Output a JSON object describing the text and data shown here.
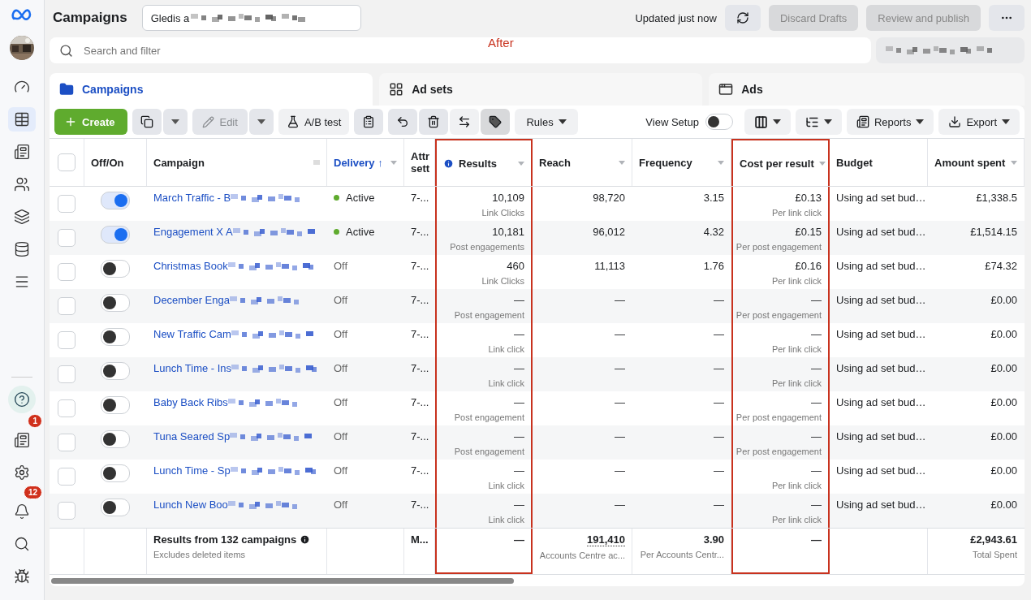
{
  "page_title": "Campaigns",
  "account": {
    "name": "Gledis a"
  },
  "updated": "Updated just now",
  "header_buttons": [
    {
      "label": "Discard Drafts",
      "disabled": true
    },
    {
      "label": "Review and publish",
      "disabled": true
    }
  ],
  "search": {
    "placeholder": "Search and filter"
  },
  "annotation": {
    "label": "After"
  },
  "sidebar": {
    "items": [
      {
        "kind": "gauge",
        "selected": false
      },
      {
        "kind": "table",
        "selected": true
      },
      {
        "kind": "pages",
        "selected": false
      },
      {
        "kind": "people",
        "selected": false
      },
      {
        "kind": "layers",
        "selected": false
      },
      {
        "kind": "stack",
        "selected": false
      },
      {
        "kind": "menu",
        "selected": false
      }
    ],
    "bottom": [
      {
        "kind": "help"
      },
      {
        "kind": "news",
        "badge": "1"
      },
      {
        "kind": "settings"
      },
      {
        "kind": "bell",
        "badge": "12"
      },
      {
        "kind": "search"
      },
      {
        "kind": "bug"
      }
    ]
  },
  "tabs": [
    {
      "kind": "campaigns",
      "label": "Campaigns",
      "selected": true
    },
    {
      "kind": "adsets",
      "label": "Ad sets",
      "selected": false
    },
    {
      "kind": "ads",
      "label": "Ads",
      "selected": false
    }
  ],
  "toolbar": {
    "create": "Create",
    "edit": {
      "label": "Edit",
      "disabled": true
    },
    "ab_test": "A/B test",
    "rules": "Rules",
    "view_setup": {
      "label": "View Setup",
      "on": false
    },
    "reports": "Reports",
    "export": "Export"
  },
  "table": {
    "columns": [
      {
        "kind": "check",
        "checked": false
      },
      {
        "kind": "text",
        "label": "Off/On"
      },
      {
        "kind": "handle",
        "label": "Campaign"
      },
      {
        "kind": "sort",
        "label": "Delivery",
        "sort_mark": "↑",
        "sorted": true
      },
      {
        "kind": "split",
        "label": "Attr",
        "label2": "sett"
      },
      {
        "kind": "info",
        "label": "Results",
        "highlighted": true
      },
      {
        "kind": "text",
        "label": "Reach",
        "highlighted": false
      },
      {
        "kind": "text",
        "label": "Frequency"
      },
      {
        "kind": "text",
        "label": "Cost per result",
        "highlighted": true
      },
      {
        "kind": "text",
        "label": "Budget"
      },
      {
        "kind": "text",
        "label": "Amount spent"
      }
    ],
    "rows": [
      {
        "checked": false,
        "on": true,
        "name": "March Traffic - B",
        "delivery": "Active",
        "active": true,
        "attribution": "7-...",
        "results": "10,109",
        "results_type": "Link Clicks",
        "reach": "98,720",
        "frequency": "3.15",
        "cost": "£0.13",
        "cost_type": "Per link click",
        "budget": "Using ad set bud…",
        "spent": "£1,338.5"
      },
      {
        "checked": false,
        "on": true,
        "name": "Engagement X A",
        "delivery": "Active",
        "active": true,
        "attribution": "7-...",
        "results": "10,181",
        "results_type": "Post engagements",
        "reach": "96,012",
        "frequency": "4.32",
        "cost": "£0.15",
        "cost_type": "Per post engagement",
        "budget": "Using ad set bud…",
        "spent": "£1,514.15"
      },
      {
        "checked": false,
        "on": false,
        "name": "Christmas Book",
        "delivery": "Off",
        "active": false,
        "attribution": "7-...",
        "results": "460",
        "results_type": "Link Clicks",
        "reach": "11,113",
        "frequency": "1.76",
        "cost": "£0.16",
        "cost_type": "Per link click",
        "budget": "Using ad set bud…",
        "spent": "£74.32"
      },
      {
        "checked": false,
        "on": false,
        "name": "December Enga",
        "delivery": "Off",
        "active": false,
        "attribution": "7-...",
        "results": "—",
        "results_type": "Post engagement",
        "reach": "—",
        "frequency": "—",
        "cost": "—",
        "cost_type": "Per post engagement",
        "budget": "Using ad set bud…",
        "spent": "£0.00"
      },
      {
        "checked": false,
        "on": false,
        "name": "New Traffic Cam",
        "delivery": "Off",
        "active": false,
        "attribution": "7-...",
        "results": "—",
        "results_type": "Link click",
        "reach": "—",
        "frequency": "—",
        "cost": "—",
        "cost_type": "Per link click",
        "budget": "Using ad set bud…",
        "spent": "£0.00"
      },
      {
        "checked": false,
        "on": false,
        "name": "Lunch Time - Ins",
        "delivery": "Off",
        "active": false,
        "attribution": "7-...",
        "results": "—",
        "results_type": "Link click",
        "reach": "—",
        "frequency": "—",
        "cost": "—",
        "cost_type": "Per link click",
        "budget": "Using ad set bud…",
        "spent": "£0.00"
      },
      {
        "checked": false,
        "on": false,
        "name": "Baby Back Ribs",
        "delivery": "Off",
        "active": false,
        "attribution": "7-...",
        "results": "—",
        "results_type": "Post engagement",
        "reach": "—",
        "frequency": "—",
        "cost": "—",
        "cost_type": "Per post engagement",
        "budget": "Using ad set bud…",
        "spent": "£0.00"
      },
      {
        "checked": false,
        "on": false,
        "name": "Tuna Seared Sp",
        "delivery": "Off",
        "active": false,
        "attribution": "7-...",
        "results": "—",
        "results_type": "Post engagement",
        "reach": "—",
        "frequency": "—",
        "cost": "—",
        "cost_type": "Per post engagement",
        "budget": "Using ad set bud…",
        "spent": "£0.00"
      },
      {
        "checked": false,
        "on": false,
        "name": "Lunch Time - Sp",
        "delivery": "Off",
        "active": false,
        "attribution": "7-...",
        "results": "—",
        "results_type": "Link click",
        "reach": "—",
        "frequency": "—",
        "cost": "—",
        "cost_type": "Per link click",
        "budget": "Using ad set bud…",
        "spent": "£0.00"
      },
      {
        "checked": false,
        "on": false,
        "name": "Lunch New Boo",
        "delivery": "Off",
        "active": false,
        "attribution": "7-...",
        "results": "—",
        "results_type": "Link click",
        "reach": "—",
        "frequency": "—",
        "cost": "—",
        "cost_type": "Per link click",
        "budget": "Using ad set bud…",
        "spent": "£0.00"
      }
    ],
    "footer": {
      "title": "Results from 132 campaigns",
      "note": "Excludes deleted items",
      "attribution": "M...",
      "results": "—",
      "reach": "191,410",
      "reach_note": "Accounts Centre ac...",
      "frequency": "3.90",
      "frequency_note": "Per Accounts Centr...",
      "cost": "—",
      "spent": "£2,943.61",
      "spent_note": "Total Spent"
    }
  }
}
